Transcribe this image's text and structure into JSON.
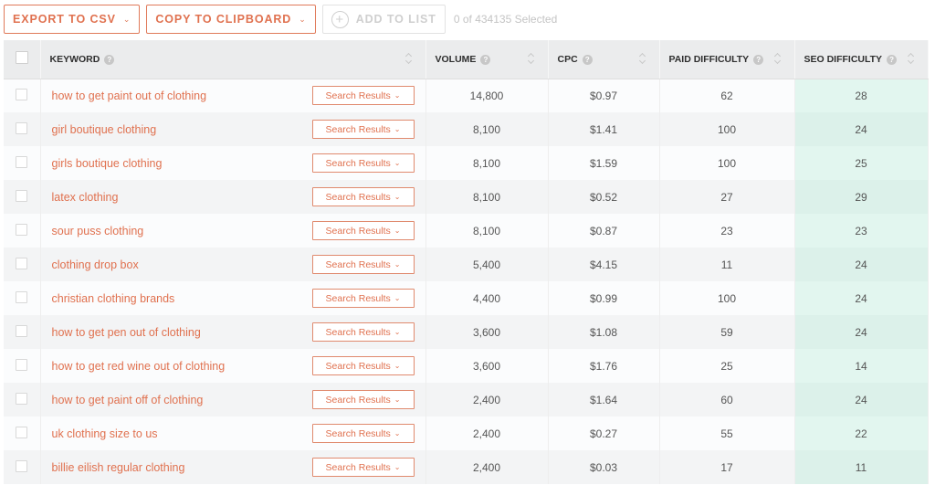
{
  "toolbar": {
    "export_label": "EXPORT TO CSV",
    "copy_label": "COPY TO CLIPBOARD",
    "add_label": "ADD TO LIST",
    "selected_text": "0 of 434135 Selected"
  },
  "colors": {
    "accent": "#e0714f",
    "header_bg": "#ebeced",
    "seo_column_bg": "#e2f6ef",
    "disabled": "#cfcfcf"
  },
  "table": {
    "columns": {
      "keyword": "KEYWORD",
      "volume": "VOLUME",
      "cpc": "CPC",
      "paid": "PAID DIFFICULTY",
      "seo": "SEO DIFFICULTY"
    },
    "search_results_label": "Search Results",
    "rows": [
      {
        "keyword": "how to get paint out of clothing",
        "volume": "14,800",
        "cpc": "$0.97",
        "paid": "62",
        "seo": "28"
      },
      {
        "keyword": "girl boutique clothing",
        "volume": "8,100",
        "cpc": "$1.41",
        "paid": "100",
        "seo": "24"
      },
      {
        "keyword": "girls boutique clothing",
        "volume": "8,100",
        "cpc": "$1.59",
        "paid": "100",
        "seo": "25"
      },
      {
        "keyword": "latex clothing",
        "volume": "8,100",
        "cpc": "$0.52",
        "paid": "27",
        "seo": "29"
      },
      {
        "keyword": "sour puss clothing",
        "volume": "8,100",
        "cpc": "$0.87",
        "paid": "23",
        "seo": "23"
      },
      {
        "keyword": "clothing drop box",
        "volume": "5,400",
        "cpc": "$4.15",
        "paid": "11",
        "seo": "24"
      },
      {
        "keyword": "christian clothing brands",
        "volume": "4,400",
        "cpc": "$0.99",
        "paid": "100",
        "seo": "24"
      },
      {
        "keyword": "how to get pen out of clothing",
        "volume": "3,600",
        "cpc": "$1.08",
        "paid": "59",
        "seo": "24"
      },
      {
        "keyword": "how to get red wine out of clothing",
        "volume": "3,600",
        "cpc": "$1.76",
        "paid": "25",
        "seo": "14"
      },
      {
        "keyword": "how to get paint off of clothing",
        "volume": "2,400",
        "cpc": "$1.64",
        "paid": "60",
        "seo": "24"
      },
      {
        "keyword": "uk clothing size to us",
        "volume": "2,400",
        "cpc": "$0.27",
        "paid": "55",
        "seo": "22"
      },
      {
        "keyword": "billie eilish regular clothing",
        "volume": "2,400",
        "cpc": "$0.03",
        "paid": "17",
        "seo": "11"
      }
    ]
  }
}
